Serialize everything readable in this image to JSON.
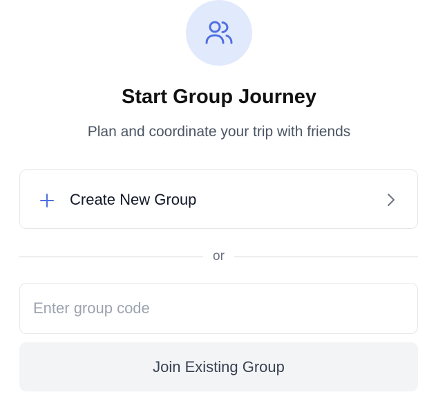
{
  "header": {
    "icon": "users-icon",
    "title": "Start Group Journey",
    "subtitle": "Plan and coordinate your trip with friends"
  },
  "create_option": {
    "icon": "plus-icon",
    "label": "Create New Group",
    "trailing_icon": "chevron-right-icon"
  },
  "divider": {
    "text": "or"
  },
  "join": {
    "input_placeholder": "Enter group code",
    "input_value": "",
    "button_label": "Join Existing Group"
  },
  "colors": {
    "accent": "#4f6fe0",
    "icon_background": "#e1eafc",
    "button_background": "#f3f4f6",
    "border": "#e5e7eb"
  }
}
